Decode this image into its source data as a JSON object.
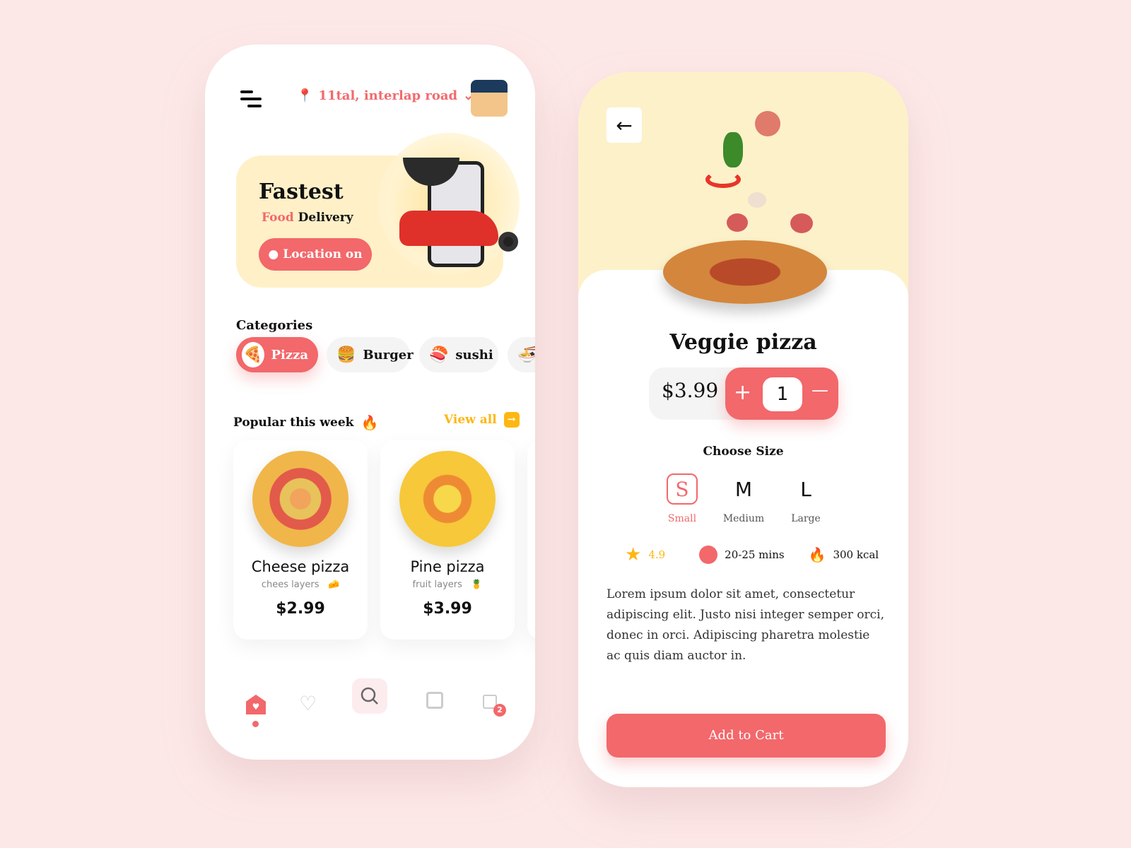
{
  "colors": {
    "accent": "#f2686b",
    "yellow": "#fdb713",
    "banner": "#fff0c8"
  },
  "home": {
    "location": "11tal, interlap road",
    "banner": {
      "title": "Fastest",
      "subtitle_accent": "Food",
      "subtitle": "Delivery",
      "button": "Location on"
    },
    "categories_title": "Categories",
    "categories": [
      {
        "label": "Pizza",
        "icon": "🍕"
      },
      {
        "label": "Burger",
        "icon": "🍔"
      },
      {
        "label": "sushi",
        "icon": "🍣"
      },
      {
        "label": "",
        "icon": "🍜"
      }
    ],
    "popular_title": "Popular this week",
    "view_all": "View all",
    "items": [
      {
        "name": "Cheese pizza",
        "desc": "chees layers",
        "icon": "🧀",
        "price": "$2.99"
      },
      {
        "name": "Pine pizza",
        "desc": "fruit layers",
        "icon": "🍍",
        "price": "$3.99"
      }
    ],
    "nav": [
      "home-icon",
      "heart-icon",
      "search-icon",
      "store-icon",
      "bag-icon"
    ],
    "cart_count": "2"
  },
  "detail": {
    "title": "Veggie pizza",
    "price": "$3.99",
    "quantity": "1",
    "plus": "+",
    "minus": "—",
    "size_title": "Choose Size",
    "sizes": [
      {
        "letter": "S",
        "label": "Small",
        "selected": true
      },
      {
        "letter": "M",
        "label": "Medium"
      },
      {
        "letter": "L",
        "label": "Large"
      }
    ],
    "rating": "4.9",
    "time": "20-25 mins",
    "kcal": "300 kcal",
    "description": "Lorem ipsum dolor sit amet, consectetur adipiscing elit. Justo nisi integer semper orci, donec in orci. Adipiscing pharetra molestie ac quis diam auctor in.",
    "add_to_cart": "Add to Cart"
  }
}
